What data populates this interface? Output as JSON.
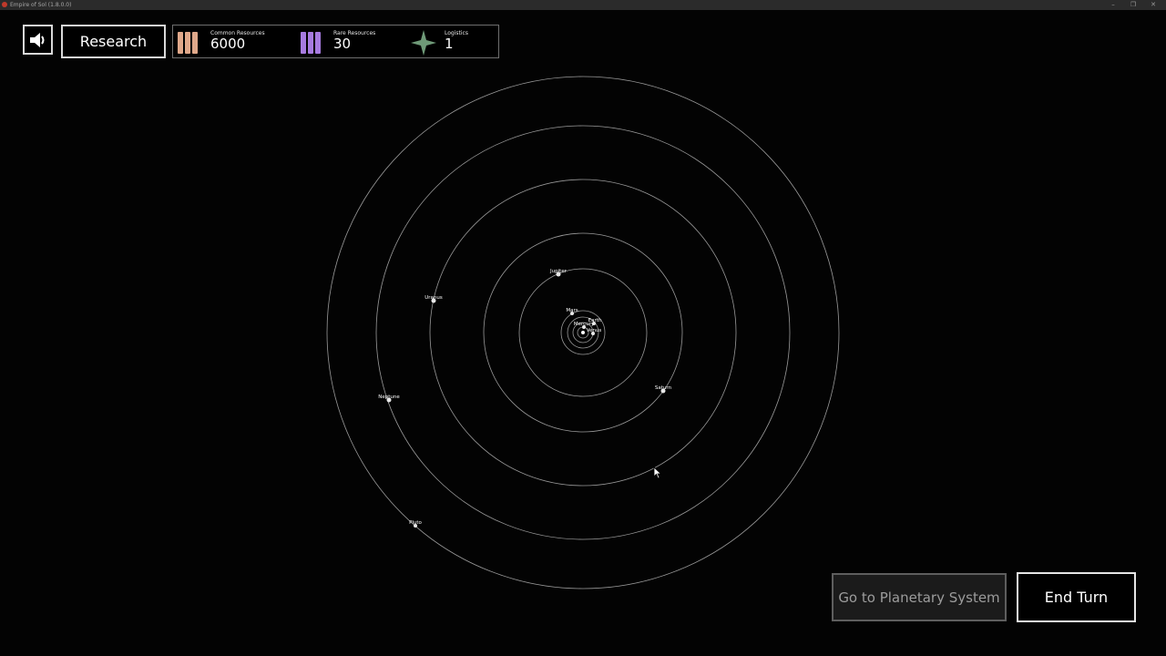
{
  "window": {
    "title": "Empire of Sol (1.8.0.0)",
    "minimize": "–",
    "restore": "❐",
    "close": "✕"
  },
  "hud": {
    "research_label": "Research",
    "sound_icon": "speaker-icon",
    "resources": [
      {
        "label": "Common Resources",
        "value": "6000",
        "icon": "common-resources-icon",
        "color": "#e0a88a"
      },
      {
        "label": "Rare Resources",
        "value": "30",
        "icon": "rare-resources-icon",
        "color": "#a77be0"
      },
      {
        "label": "Logistics",
        "value": "1",
        "icon": "logistics-star-icon",
        "color": "#6f9a78"
      }
    ]
  },
  "solar_system": {
    "orbit_color": "#9a9a9a",
    "planet_color": "#e8e8e8",
    "sun_label": "",
    "planets": [
      {
        "name": "Mercury"
      },
      {
        "name": "Venus"
      },
      {
        "name": "Earth"
      },
      {
        "name": "Mars"
      },
      {
        "name": "Jupiter"
      },
      {
        "name": "Saturn"
      },
      {
        "name": "Uranus"
      },
      {
        "name": "Neptune"
      },
      {
        "name": "Pluto"
      }
    ]
  },
  "actions": {
    "planetary_label": "Go to Planetary System",
    "end_turn_label": "End Turn"
  }
}
